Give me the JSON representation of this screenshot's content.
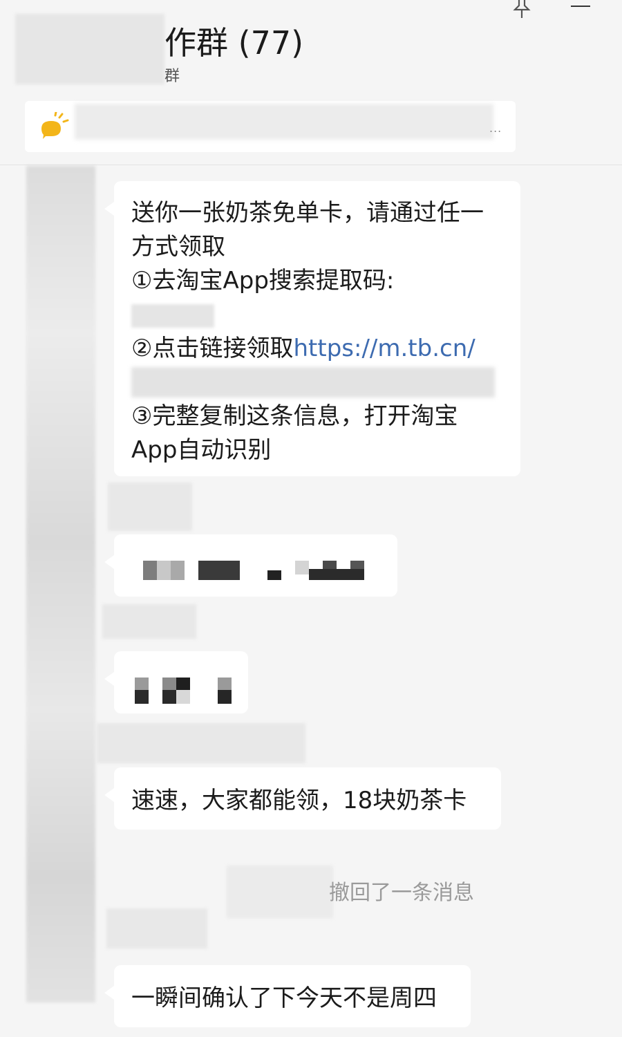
{
  "header": {
    "title": "作群 (77)",
    "subtitle": "群",
    "notice_more": "..."
  },
  "messages": {
    "m1": {
      "line1": "送你一张奶茶免单卡，请通过任一",
      "line2": "方式领取",
      "line3": "①去淘宝App搜索提取码:",
      "line5_prefix": "②点击链接领取",
      "line5_link": "https://m.tb.cn/",
      "line7": "③完整复制这条信息，打开淘宝",
      "line8": "App自动识别"
    },
    "m4": "速速，大家都能领，18块奶茶卡",
    "recall": "撤回了一条消息",
    "m5": "一瞬间确认了下今天不是周四"
  },
  "colors": {
    "background": "#f5f5f5",
    "bubble": "#ffffff",
    "link": "#3d6bb0",
    "system_text": "#9a9a9a"
  }
}
